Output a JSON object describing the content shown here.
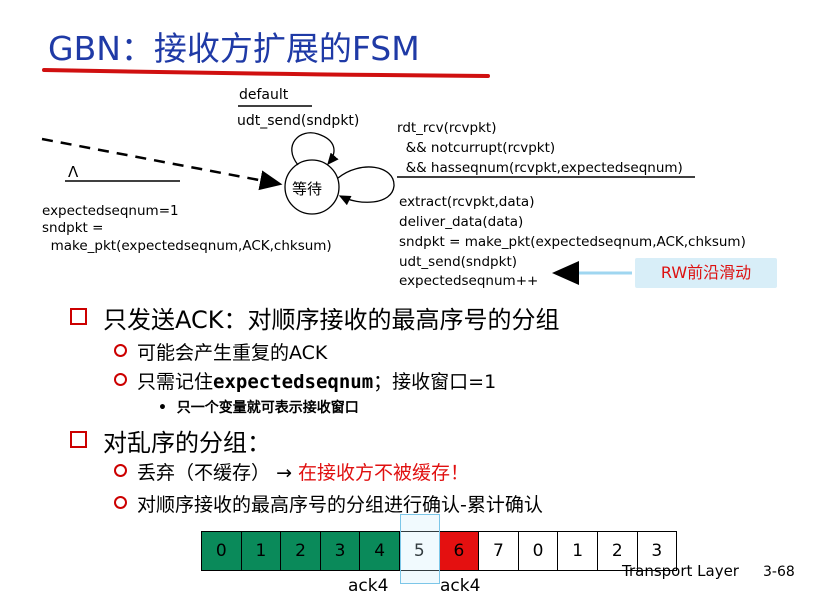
{
  "title": "GBN：接收方扩展的FSM",
  "fsm": {
    "state": "等待",
    "default_label": "default",
    "default_action": "udt_send(sndpkt)",
    "init_event": "Λ",
    "init_actions": [
      "expectedseqnum=1",
      "sndpkt =",
      "  make_pkt(expectedseqnum,ACK,chksum)"
    ],
    "loop_event": [
      "rdt_rcv(rcvpkt)",
      "  && notcurrupt(rcvpkt)",
      "  && hasseqnum(rcvpkt,expectedseqnum)"
    ],
    "loop_actions": [
      "extract(rcvpkt,data)",
      "deliver_data(data)",
      "sndpkt = make_pkt(expectedseqnum,ACK,chksum)",
      "udt_send(sndpkt)",
      "expectedseqnum++"
    ],
    "rw_label": "RW前沿滑动"
  },
  "bullets": {
    "b1": "只发送ACK：对顺序接收的最高序号的分组",
    "b1_1": "可能会产生重复的ACK",
    "b1_2_pre": "只需记住",
    "b1_2_code": "expectedseqnum",
    "b1_2_post": "；接收窗口=1",
    "b1_2_1": "只一个变量就可表示接收窗口",
    "b2": "对乱序的分组：",
    "b2_1_pre": "丢弃（不缓存）",
    "b2_1_arrow": "→",
    "b2_1_red": "在接收方不被缓存！",
    "b2_2": "对顺序接收的最高序号的分组进行确认-累计确认"
  },
  "sequence": [
    "0",
    "1",
    "2",
    "3",
    "4",
    "5",
    "6",
    "7",
    "0",
    "1",
    "2",
    "3"
  ],
  "sequence_states": [
    "acked",
    "acked",
    "acked",
    "acked",
    "acked",
    "window",
    "discarded",
    "empty",
    "empty",
    "empty",
    "empty",
    "empty"
  ],
  "colors": {
    "acked": "#0a8a5a",
    "discarded": "#e41010",
    "title": "#1f3aa6",
    "accent": "#c00000"
  },
  "acks": [
    "ack4",
    "ack4"
  ],
  "footer": {
    "layer": "Transport Layer",
    "page": "3-68"
  }
}
